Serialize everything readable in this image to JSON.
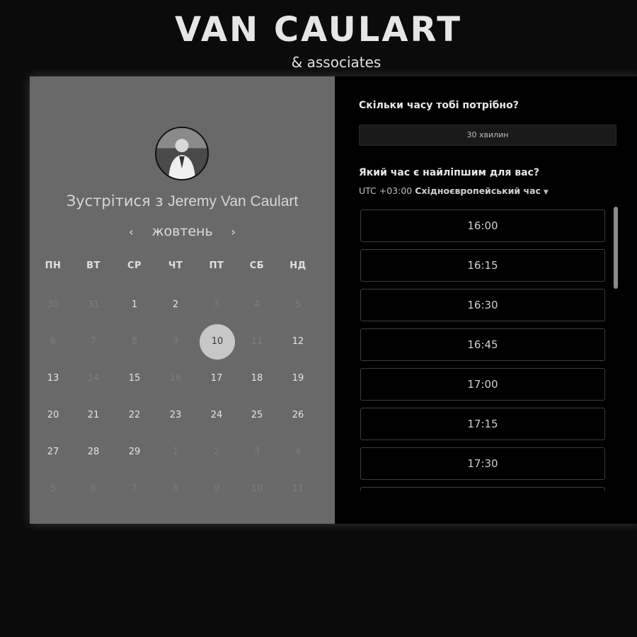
{
  "brand": {
    "title": "VAN CAULART",
    "subtitle": "& associates"
  },
  "calendar": {
    "title_prefix": "Зустрітися з",
    "title_name": "Jeremy Van Caulart",
    "month": "жовтень",
    "prev_icon": "‹",
    "next_icon": "›",
    "weekdays": [
      "ПН",
      "ВТ",
      "СР",
      "ЧТ",
      "ПТ",
      "СБ",
      "НД"
    ],
    "weeks": [
      [
        {
          "d": "30",
          "m": true
        },
        {
          "d": "31",
          "m": true
        },
        {
          "d": "1",
          "m": false
        },
        {
          "d": "2",
          "m": false
        },
        {
          "d": "3",
          "m": true
        },
        {
          "d": "4",
          "m": true
        },
        {
          "d": "5",
          "m": true
        }
      ],
      [
        {
          "d": "6",
          "m": true
        },
        {
          "d": "7",
          "m": true
        },
        {
          "d": "8",
          "m": true
        },
        {
          "d": "9",
          "m": true
        },
        {
          "d": "10",
          "m": false,
          "sel": true
        },
        {
          "d": "11",
          "m": true
        },
        {
          "d": "12",
          "m": false
        }
      ],
      [
        {
          "d": "13",
          "m": false
        },
        {
          "d": "14",
          "m": true
        },
        {
          "d": "15",
          "m": false
        },
        {
          "d": "16",
          "m": true
        },
        {
          "d": "17",
          "m": false
        },
        {
          "d": "18",
          "m": false
        },
        {
          "d": "19",
          "m": false
        }
      ],
      [
        {
          "d": "20",
          "m": false
        },
        {
          "d": "21",
          "m": false
        },
        {
          "d": "22",
          "m": false
        },
        {
          "d": "23",
          "m": false
        },
        {
          "d": "24",
          "m": false
        },
        {
          "d": "25",
          "m": false
        },
        {
          "d": "26",
          "m": false
        }
      ],
      [
        {
          "d": "27",
          "m": false
        },
        {
          "d": "28",
          "m": false
        },
        {
          "d": "29",
          "m": false
        },
        {
          "d": "1",
          "m": true
        },
        {
          "d": "2",
          "m": true
        },
        {
          "d": "3",
          "m": true
        },
        {
          "d": "4",
          "m": true
        }
      ],
      [
        {
          "d": "5",
          "m": true
        },
        {
          "d": "6",
          "m": true
        },
        {
          "d": "7",
          "m": true
        },
        {
          "d": "8",
          "m": true
        },
        {
          "d": "9",
          "m": true
        },
        {
          "d": "10",
          "m": true
        },
        {
          "d": "11",
          "m": true
        }
      ]
    ]
  },
  "booking": {
    "duration_question": "Скільки часу тобі потрібно?",
    "duration_value": "30 хвилин",
    "time_question": "Який час є найліпшим для вас?",
    "tz_offset": "UTC +03:00",
    "tz_name": "Східноєвропейський час",
    "slots": [
      "16:00",
      "16:15",
      "16:30",
      "16:45",
      "17:00",
      "17:15",
      "17:30",
      ""
    ]
  }
}
